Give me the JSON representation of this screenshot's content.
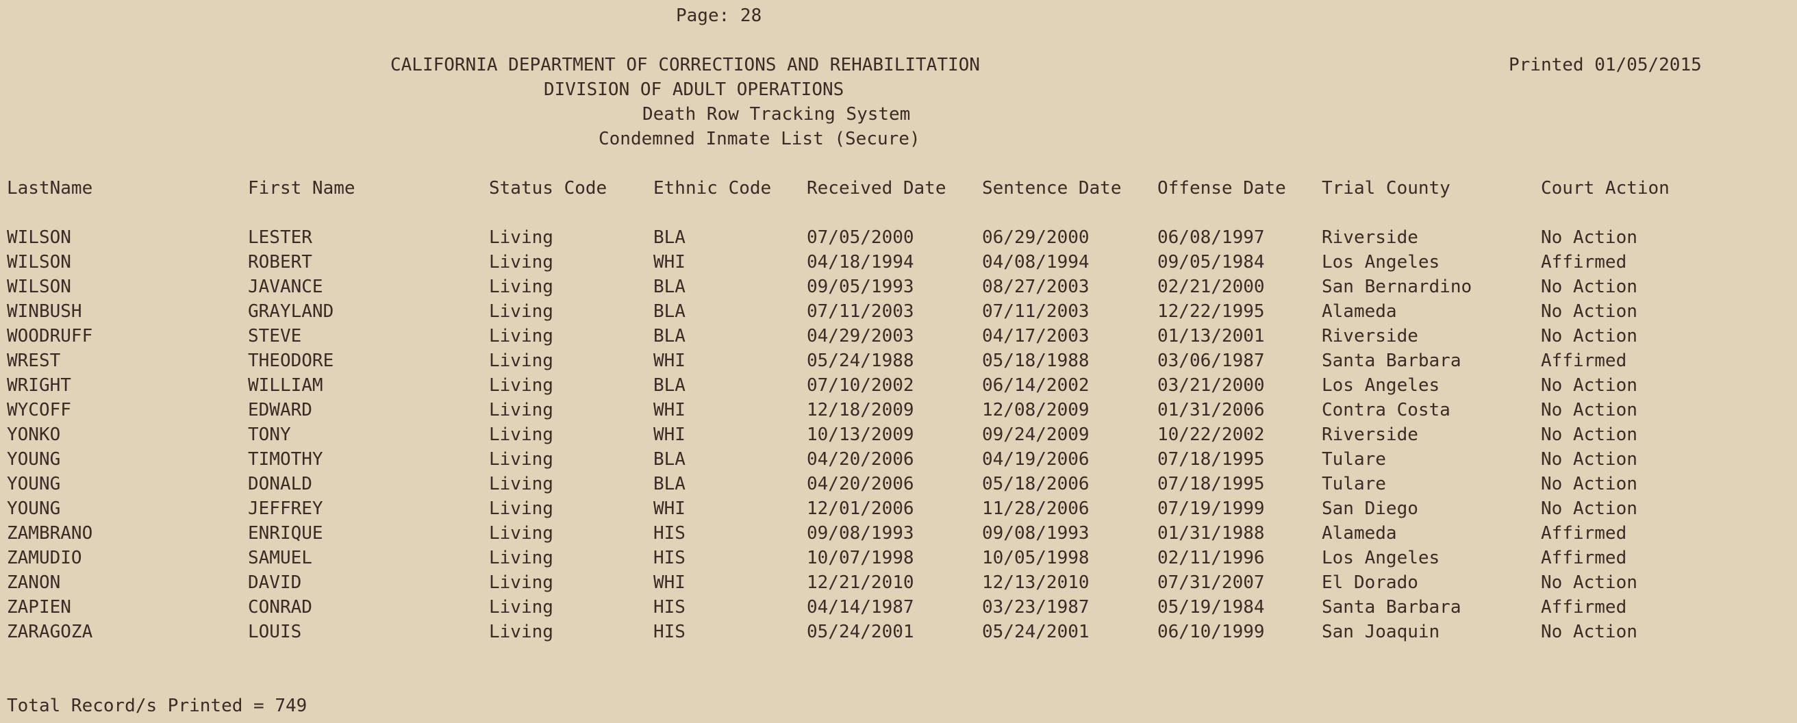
{
  "page_label": "Page: 28",
  "header": {
    "line1": "CALIFORNIA DEPARTMENT OF CORRECTIONS AND REHABILITATION",
    "line2": "DIVISION OF ADULT OPERATIONS",
    "line3": "Death Row Tracking System",
    "line4": "Condemned Inmate List (Secure)",
    "printed": "Printed 01/05/2015"
  },
  "columns": [
    "LastName",
    "First Name",
    "Status Code",
    "Ethnic Code",
    "Received Date",
    "Sentence Date",
    "Offense Date",
    "Trial County",
    "Court Action"
  ],
  "rows": [
    [
      "WILSON",
      "LESTER",
      "Living",
      "BLA",
      "07/05/2000",
      "06/29/2000",
      "06/08/1997",
      "Riverside",
      "No Action"
    ],
    [
      "WILSON",
      "ROBERT",
      "Living",
      "WHI",
      "04/18/1994",
      "04/08/1994",
      "09/05/1984",
      "Los Angeles",
      "Affirmed"
    ],
    [
      "WILSON",
      "JAVANCE",
      "Living",
      "BLA",
      "09/05/1993",
      "08/27/2003",
      "02/21/2000",
      "San Bernardino",
      "No Action"
    ],
    [
      "WINBUSH",
      "GRAYLAND",
      "Living",
      "BLA",
      "07/11/2003",
      "07/11/2003",
      "12/22/1995",
      "Alameda",
      "No Action"
    ],
    [
      "WOODRUFF",
      "STEVE",
      "Living",
      "BLA",
      "04/29/2003",
      "04/17/2003",
      "01/13/2001",
      "Riverside",
      "No Action"
    ],
    [
      "WREST",
      "THEODORE",
      "Living",
      "WHI",
      "05/24/1988",
      "05/18/1988",
      "03/06/1987",
      "Santa Barbara",
      "Affirmed"
    ],
    [
      "WRIGHT",
      "WILLIAM",
      "Living",
      "BLA",
      "07/10/2002",
      "06/14/2002",
      "03/21/2000",
      "Los Angeles",
      "No Action"
    ],
    [
      "WYCOFF",
      "EDWARD",
      "Living",
      "WHI",
      "12/18/2009",
      "12/08/2009",
      "01/31/2006",
      "Contra Costa",
      "No Action"
    ],
    [
      "YONKO",
      "TONY",
      "Living",
      "WHI",
      "10/13/2009",
      "09/24/2009",
      "10/22/2002",
      "Riverside",
      "No Action"
    ],
    [
      "YOUNG",
      "TIMOTHY",
      "Living",
      "BLA",
      "04/20/2006",
      "04/19/2006",
      "07/18/1995",
      "Tulare",
      "No Action"
    ],
    [
      "YOUNG",
      "DONALD",
      "Living",
      "BLA",
      "04/20/2006",
      "05/18/2006",
      "07/18/1995",
      "Tulare",
      "No Action"
    ],
    [
      "YOUNG",
      "JEFFREY",
      "Living",
      "WHI",
      "12/01/2006",
      "11/28/2006",
      "07/19/1999",
      "San Diego",
      "No Action"
    ],
    [
      "ZAMBRANO",
      "ENRIQUE",
      "Living",
      "HIS",
      "09/08/1993",
      "09/08/1993",
      "01/31/1988",
      "Alameda",
      "Affirmed"
    ],
    [
      "ZAMUDIO",
      "SAMUEL",
      "Living",
      "HIS",
      "10/07/1998",
      "10/05/1998",
      "02/11/1996",
      "Los Angeles",
      "Affirmed"
    ],
    [
      "ZANON",
      "DAVID",
      "Living",
      "WHI",
      "12/21/2010",
      "12/13/2010",
      "07/31/2007",
      "El Dorado",
      "No Action"
    ],
    [
      "ZAPIEN",
      "CONRAD",
      "Living",
      "HIS",
      "04/14/1987",
      "03/23/1987",
      "05/19/1984",
      "Santa Barbara",
      "Affirmed"
    ],
    [
      "ZARAGOZA",
      "LOUIS",
      "Living",
      "HIS",
      "05/24/2001",
      "05/24/2001",
      "06/10/1999",
      "San Joaquin",
      "No Action"
    ]
  ],
  "footer": "Total Record/s Printed = 749",
  "colors": {
    "background": "#e0d3b8",
    "text": "#3b2a26"
  }
}
